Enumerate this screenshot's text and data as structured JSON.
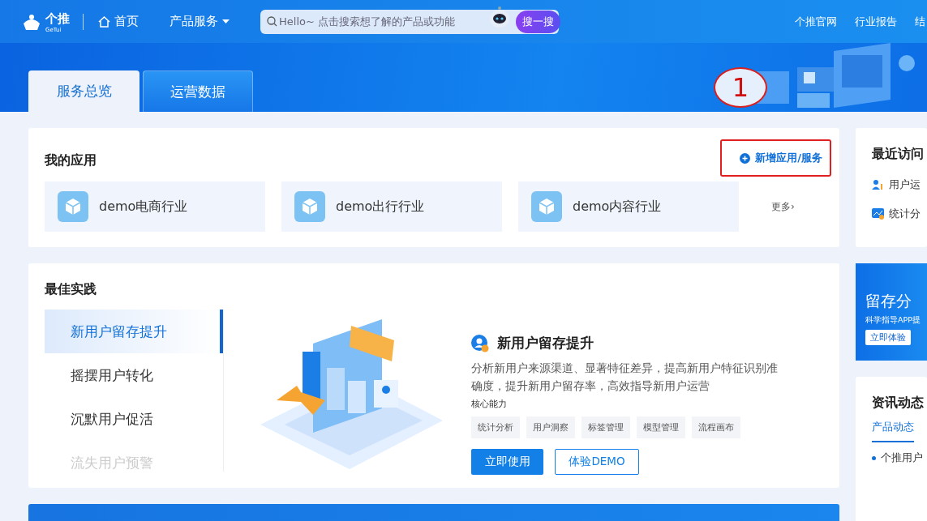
{
  "header": {
    "logo": {
      "name": "个推",
      "sub": "GeTui"
    },
    "nav": [
      {
        "label": "首页",
        "kind": "home"
      },
      {
        "label": "产品服务",
        "kind": "dropdown"
      }
    ],
    "search": {
      "placeholder": "Hello~ 点击搜索想了解的产品或功能",
      "button": "搜一搜"
    },
    "links": [
      "个推官网",
      "行业报告",
      "结"
    ]
  },
  "banner": {
    "tabs": [
      {
        "label": "服务总览",
        "selected": true
      },
      {
        "label": "运营数据",
        "selected": false
      }
    ],
    "annotation": "1"
  },
  "apps": {
    "title": "我的应用",
    "add": "新增应用/服务",
    "items": [
      "demo电商行业",
      "demo出行行业",
      "demo内容行业"
    ],
    "more": "更多›"
  },
  "practice": {
    "title": "最佳实践",
    "items": [
      {
        "label": "新用户留存提升",
        "selected": true,
        "faded": false
      },
      {
        "label": "摇摆用户转化",
        "selected": false,
        "faded": false
      },
      {
        "label": "沉默用户促活",
        "selected": false,
        "faded": false
      },
      {
        "label": "流失用户预警",
        "selected": false,
        "faded": true
      }
    ],
    "detail": {
      "title": "新用户留存提升",
      "description": "分析新用户来源渠道、显著特征差异，提高新用户特征识别准确度，提升新用户留存率，高效指导新用户运营",
      "capability_label": "核心能力",
      "tags": [
        "统计分析",
        "用户洞察",
        "标签管理",
        "模型管理",
        "流程画布"
      ],
      "primary": "立即使用",
      "secondary": "体验DEMO"
    }
  },
  "recent": {
    "title": "最近访问",
    "items": [
      "用户运",
      "统计分"
    ]
  },
  "promo": {
    "title": "留存分",
    "subtitle": "科学指导APP提",
    "button": "立即体验"
  },
  "news": {
    "title": "资讯动态",
    "tabs": [
      {
        "label": "产品动态",
        "selected": true
      }
    ],
    "items": [
      "个推用户"
    ]
  }
}
